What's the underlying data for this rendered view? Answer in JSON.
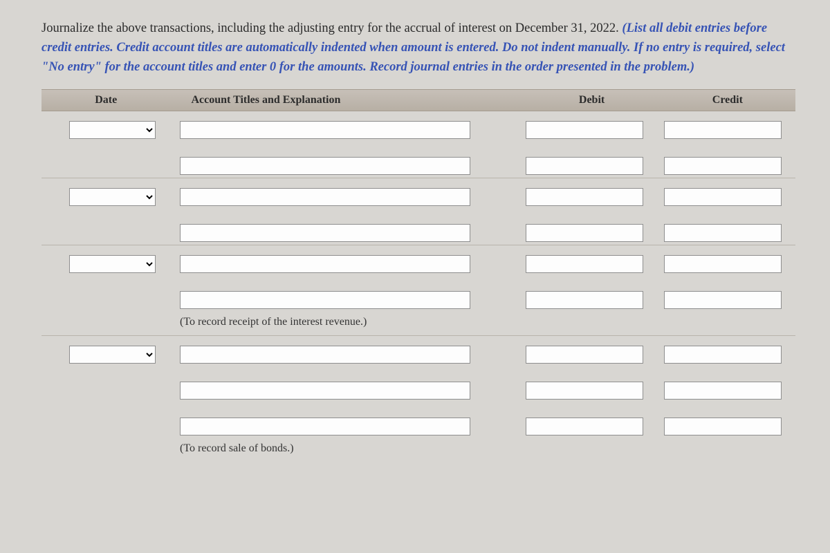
{
  "instructions": {
    "plain": "Journalize the above transactions, including the adjusting entry for the accrual of interest on December 31, 2022. ",
    "italic": "(List all debit entries before credit entries. Credit account titles are automatically indented when amount is entered. Do not indent manually. If no entry is required, select \"No entry\" for the account titles and enter 0 for the amounts. Record journal entries in the order presented in the problem.)"
  },
  "headers": {
    "date": "Date",
    "account": "Account Titles and Explanation",
    "debit": "Debit",
    "credit": "Credit"
  },
  "notes": {
    "interest": "(To record receipt of the interest revenue.)",
    "sale": "(To record sale of bonds.)"
  }
}
